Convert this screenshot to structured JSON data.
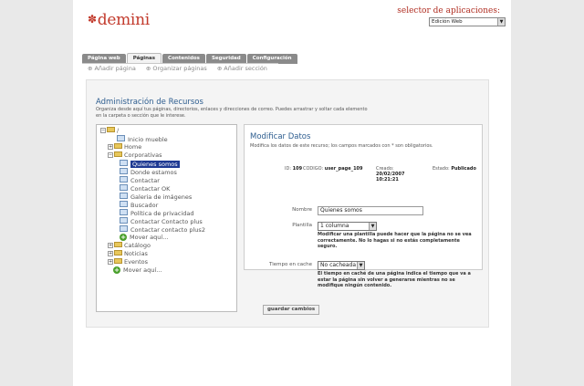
{
  "header": {
    "logo": "demini",
    "app_selector_label": "selector de aplicaciones:",
    "app_selector_value": "Edición Web"
  },
  "tabs": [
    {
      "label": "Página web"
    },
    {
      "label": "Páginas"
    },
    {
      "label": "Contenidos"
    },
    {
      "label": "Seguridad"
    },
    {
      "label": "Configuración"
    }
  ],
  "subactions": [
    "Añadir página",
    "Organizar páginas",
    "Añadir sección"
  ],
  "admin": {
    "title": "Administración de Recursos",
    "description": "Organiza desde aquí tus páginas, directorios, enlaces y direcciones de correo. Puedes arrastrar y soltar cada elemento en la carpeta o sección que le interese."
  },
  "tree": {
    "root": "/",
    "items": [
      {
        "label": "Inicio mueble",
        "type": "doc"
      },
      {
        "label": "Home",
        "type": "folder"
      },
      {
        "label": "Corporativas",
        "type": "folder"
      },
      {
        "label": "Quienes somos",
        "type": "doc"
      },
      {
        "label": "Donde estamos",
        "type": "doc"
      },
      {
        "label": "Contactar",
        "type": "doc"
      },
      {
        "label": "Contactar OK",
        "type": "doc"
      },
      {
        "label": "Galeria de imágenes",
        "type": "doc"
      },
      {
        "label": "Buscador",
        "type": "doc"
      },
      {
        "label": "Política de privacidad",
        "type": "doc"
      },
      {
        "label": "Contactar Contacto plus",
        "type": "doc"
      },
      {
        "label": "Contactar contacto plus2",
        "type": "doc"
      },
      {
        "label": "Mover aquí...",
        "type": "add"
      },
      {
        "label": "Catálogo",
        "type": "folder"
      },
      {
        "label": "Noticias",
        "type": "folder"
      },
      {
        "label": "Eventos",
        "type": "folder"
      },
      {
        "label": "Mover aquí...",
        "type": "add"
      }
    ]
  },
  "form": {
    "title": "Modificar Datos",
    "note": "Modifica los datos de este recurso; los campos marcados con * son obligatorios.",
    "id_label": "ID:",
    "id_value": "109",
    "code_label": "CODIGO:",
    "code_value": "user_page_109",
    "created_label": "Creado:",
    "created_value": "20/02/2007 10:21:21",
    "status_label": "Estado:",
    "status_value": "Publicado",
    "name_label": "Nombre",
    "name_value": "Quienes somos",
    "template_label": "Plantilla",
    "template_value": "1 columna",
    "template_help": "Modificar una plantilla puede hacer que la página no se vea correctamente. No lo hagas si no estás completamente seguro.",
    "cache_label": "Tiempo en cache",
    "cache_value": "No cacheada",
    "cache_help": "El tiempo en caché de una página indica el tiempo que va a estar la página sin volver a generarse mientras no se modifique ningún contenido.",
    "save_label": "guardar cambios"
  }
}
